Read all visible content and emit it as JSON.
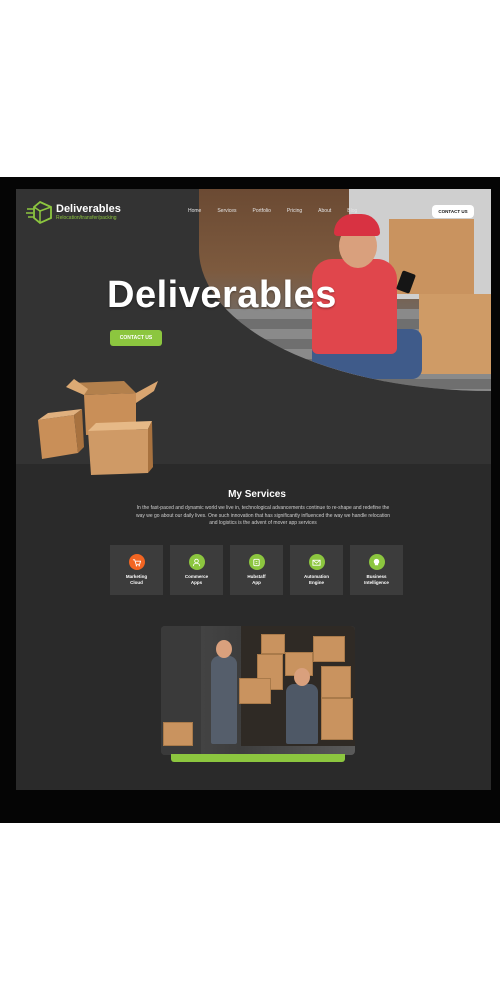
{
  "brand": {
    "name": "Deliverables",
    "tagline": "Relocation/transfer/packing",
    "accent": "#8cc63f"
  },
  "nav": {
    "items": [
      "Home",
      "Services",
      "Portfolio",
      "Pricing",
      "About",
      "Blog"
    ],
    "contact_label": "CONTACT US"
  },
  "hero": {
    "title": "Deliverables",
    "button_label": "CONTACT US"
  },
  "services": {
    "title": "My Services",
    "description": "In the fast-paced and dynamic world we live in, technological advancements continue to re-shape and redefine the way we go about our daily lives. One such innovation that has significantly influenced the way we handle relocation and logistics is the advent of mover app services",
    "cards": [
      {
        "label_1": "Marketing",
        "label_2": "Cloud",
        "icon": "cart-icon",
        "color": "#f26522"
      },
      {
        "label_1": "Commerce",
        "label_2": "Apps",
        "icon": "user-icon",
        "color": "#8cc63f"
      },
      {
        "label_1": "Hubstaff",
        "label_2": "App",
        "icon": "clock-icon",
        "color": "#8cc63f"
      },
      {
        "label_1": "Automation",
        "label_2": "Engine",
        "icon": "mail-icon",
        "color": "#8cc63f"
      },
      {
        "label_1": "Business",
        "label_2": "Intelligence",
        "icon": "lightbulb-icon",
        "color": "#8cc63f"
      }
    ]
  }
}
